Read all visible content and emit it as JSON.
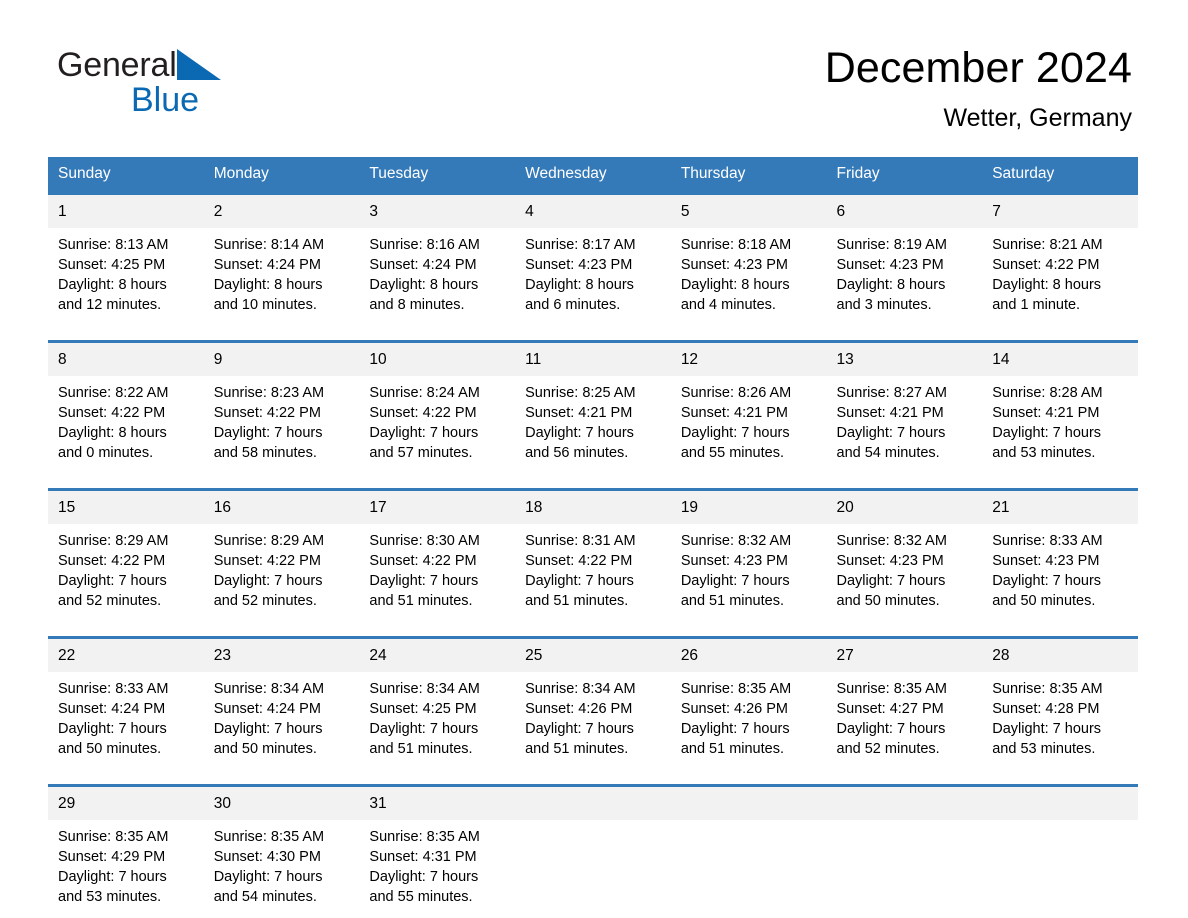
{
  "brand": {
    "name_part1": "General",
    "name_part2": "Blue",
    "triangle_color": "#0a69b2"
  },
  "header": {
    "title": "December 2024",
    "subtitle": "Wetter, Germany"
  },
  "theme": {
    "header_blue": "#3479b8",
    "row_divider_blue": "#3479b8",
    "daynum_band": "#f2f2f2",
    "text": "#000000"
  },
  "weekday_headers": [
    "Sunday",
    "Monday",
    "Tuesday",
    "Wednesday",
    "Thursday",
    "Friday",
    "Saturday"
  ],
  "weeks": [
    [
      {
        "day": "1",
        "sunrise": "Sunrise: 8:13 AM",
        "sunset": "Sunset: 4:25 PM",
        "daylight_1": "Daylight: 8 hours",
        "daylight_2": "and 12 minutes."
      },
      {
        "day": "2",
        "sunrise": "Sunrise: 8:14 AM",
        "sunset": "Sunset: 4:24 PM",
        "daylight_1": "Daylight: 8 hours",
        "daylight_2": "and 10 minutes."
      },
      {
        "day": "3",
        "sunrise": "Sunrise: 8:16 AM",
        "sunset": "Sunset: 4:24 PM",
        "daylight_1": "Daylight: 8 hours",
        "daylight_2": "and 8 minutes."
      },
      {
        "day": "4",
        "sunrise": "Sunrise: 8:17 AM",
        "sunset": "Sunset: 4:23 PM",
        "daylight_1": "Daylight: 8 hours",
        "daylight_2": "and 6 minutes."
      },
      {
        "day": "5",
        "sunrise": "Sunrise: 8:18 AM",
        "sunset": "Sunset: 4:23 PM",
        "daylight_1": "Daylight: 8 hours",
        "daylight_2": "and 4 minutes."
      },
      {
        "day": "6",
        "sunrise": "Sunrise: 8:19 AM",
        "sunset": "Sunset: 4:23 PM",
        "daylight_1": "Daylight: 8 hours",
        "daylight_2": "and 3 minutes."
      },
      {
        "day": "7",
        "sunrise": "Sunrise: 8:21 AM",
        "sunset": "Sunset: 4:22 PM",
        "daylight_1": "Daylight: 8 hours",
        "daylight_2": "and 1 minute."
      }
    ],
    [
      {
        "day": "8",
        "sunrise": "Sunrise: 8:22 AM",
        "sunset": "Sunset: 4:22 PM",
        "daylight_1": "Daylight: 8 hours",
        "daylight_2": "and 0 minutes."
      },
      {
        "day": "9",
        "sunrise": "Sunrise: 8:23 AM",
        "sunset": "Sunset: 4:22 PM",
        "daylight_1": "Daylight: 7 hours",
        "daylight_2": "and 58 minutes."
      },
      {
        "day": "10",
        "sunrise": "Sunrise: 8:24 AM",
        "sunset": "Sunset: 4:22 PM",
        "daylight_1": "Daylight: 7 hours",
        "daylight_2": "and 57 minutes."
      },
      {
        "day": "11",
        "sunrise": "Sunrise: 8:25 AM",
        "sunset": "Sunset: 4:21 PM",
        "daylight_1": "Daylight: 7 hours",
        "daylight_2": "and 56 minutes."
      },
      {
        "day": "12",
        "sunrise": "Sunrise: 8:26 AM",
        "sunset": "Sunset: 4:21 PM",
        "daylight_1": "Daylight: 7 hours",
        "daylight_2": "and 55 minutes."
      },
      {
        "day": "13",
        "sunrise": "Sunrise: 8:27 AM",
        "sunset": "Sunset: 4:21 PM",
        "daylight_1": "Daylight: 7 hours",
        "daylight_2": "and 54 minutes."
      },
      {
        "day": "14",
        "sunrise": "Sunrise: 8:28 AM",
        "sunset": "Sunset: 4:21 PM",
        "daylight_1": "Daylight: 7 hours",
        "daylight_2": "and 53 minutes."
      }
    ],
    [
      {
        "day": "15",
        "sunrise": "Sunrise: 8:29 AM",
        "sunset": "Sunset: 4:22 PM",
        "daylight_1": "Daylight: 7 hours",
        "daylight_2": "and 52 minutes."
      },
      {
        "day": "16",
        "sunrise": "Sunrise: 8:29 AM",
        "sunset": "Sunset: 4:22 PM",
        "daylight_1": "Daylight: 7 hours",
        "daylight_2": "and 52 minutes."
      },
      {
        "day": "17",
        "sunrise": "Sunrise: 8:30 AM",
        "sunset": "Sunset: 4:22 PM",
        "daylight_1": "Daylight: 7 hours",
        "daylight_2": "and 51 minutes."
      },
      {
        "day": "18",
        "sunrise": "Sunrise: 8:31 AM",
        "sunset": "Sunset: 4:22 PM",
        "daylight_1": "Daylight: 7 hours",
        "daylight_2": "and 51 minutes."
      },
      {
        "day": "19",
        "sunrise": "Sunrise: 8:32 AM",
        "sunset": "Sunset: 4:23 PM",
        "daylight_1": "Daylight: 7 hours",
        "daylight_2": "and 51 minutes."
      },
      {
        "day": "20",
        "sunrise": "Sunrise: 8:32 AM",
        "sunset": "Sunset: 4:23 PM",
        "daylight_1": "Daylight: 7 hours",
        "daylight_2": "and 50 minutes."
      },
      {
        "day": "21",
        "sunrise": "Sunrise: 8:33 AM",
        "sunset": "Sunset: 4:23 PM",
        "daylight_1": "Daylight: 7 hours",
        "daylight_2": "and 50 minutes."
      }
    ],
    [
      {
        "day": "22",
        "sunrise": "Sunrise: 8:33 AM",
        "sunset": "Sunset: 4:24 PM",
        "daylight_1": "Daylight: 7 hours",
        "daylight_2": "and 50 minutes."
      },
      {
        "day": "23",
        "sunrise": "Sunrise: 8:34 AM",
        "sunset": "Sunset: 4:24 PM",
        "daylight_1": "Daylight: 7 hours",
        "daylight_2": "and 50 minutes."
      },
      {
        "day": "24",
        "sunrise": "Sunrise: 8:34 AM",
        "sunset": "Sunset: 4:25 PM",
        "daylight_1": "Daylight: 7 hours",
        "daylight_2": "and 51 minutes."
      },
      {
        "day": "25",
        "sunrise": "Sunrise: 8:34 AM",
        "sunset": "Sunset: 4:26 PM",
        "daylight_1": "Daylight: 7 hours",
        "daylight_2": "and 51 minutes."
      },
      {
        "day": "26",
        "sunrise": "Sunrise: 8:35 AM",
        "sunset": "Sunset: 4:26 PM",
        "daylight_1": "Daylight: 7 hours",
        "daylight_2": "and 51 minutes."
      },
      {
        "day": "27",
        "sunrise": "Sunrise: 8:35 AM",
        "sunset": "Sunset: 4:27 PM",
        "daylight_1": "Daylight: 7 hours",
        "daylight_2": "and 52 minutes."
      },
      {
        "day": "28",
        "sunrise": "Sunrise: 8:35 AM",
        "sunset": "Sunset: 4:28 PM",
        "daylight_1": "Daylight: 7 hours",
        "daylight_2": "and 53 minutes."
      }
    ],
    [
      {
        "day": "29",
        "sunrise": "Sunrise: 8:35 AM",
        "sunset": "Sunset: 4:29 PM",
        "daylight_1": "Daylight: 7 hours",
        "daylight_2": "and 53 minutes."
      },
      {
        "day": "30",
        "sunrise": "Sunrise: 8:35 AM",
        "sunset": "Sunset: 4:30 PM",
        "daylight_1": "Daylight: 7 hours",
        "daylight_2": "and 54 minutes."
      },
      {
        "day": "31",
        "sunrise": "Sunrise: 8:35 AM",
        "sunset": "Sunset: 4:31 PM",
        "daylight_1": "Daylight: 7 hours",
        "daylight_2": "and 55 minutes."
      },
      {
        "day": "",
        "sunrise": "",
        "sunset": "",
        "daylight_1": "",
        "daylight_2": ""
      },
      {
        "day": "",
        "sunrise": "",
        "sunset": "",
        "daylight_1": "",
        "daylight_2": ""
      },
      {
        "day": "",
        "sunrise": "",
        "sunset": "",
        "daylight_1": "",
        "daylight_2": ""
      },
      {
        "day": "",
        "sunrise": "",
        "sunset": "",
        "daylight_1": "",
        "daylight_2": ""
      }
    ]
  ]
}
